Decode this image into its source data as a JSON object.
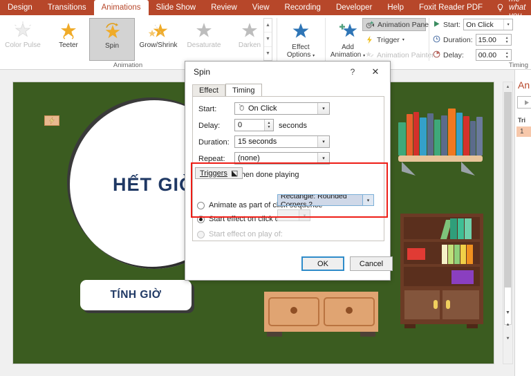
{
  "ribbon": {
    "tabs": [
      {
        "label": "Design",
        "active": false
      },
      {
        "label": "Transitions",
        "active": false
      },
      {
        "label": "Animations",
        "active": true
      },
      {
        "label": "Slide Show",
        "active": false
      },
      {
        "label": "Review",
        "active": false
      },
      {
        "label": "View",
        "active": false
      },
      {
        "label": "Recording",
        "active": false
      },
      {
        "label": "Developer",
        "active": false
      },
      {
        "label": "Help",
        "active": false
      },
      {
        "label": "Foxit Reader PDF",
        "active": false
      }
    ],
    "tellme": "Tell me what you want t",
    "animation_group": {
      "label": "Animation",
      "items": [
        {
          "label": "Color Pulse",
          "state": "disabled"
        },
        {
          "label": "Teeter",
          "state": "normal"
        },
        {
          "label": "Spin",
          "state": "selected"
        },
        {
          "label": "Grow/Shrink",
          "state": "normal"
        },
        {
          "label": "Desaturate",
          "state": "disabled"
        },
        {
          "label": "Darken",
          "state": "disabled"
        }
      ]
    },
    "effect_options": {
      "label_line1": "Effect",
      "label_line2": "Options"
    },
    "advanced_group": {
      "label": "ation",
      "add_animation_line1": "Add",
      "add_animation_line2": "Animation",
      "animation_pane": "Animation Pane",
      "trigger": "Trigger",
      "animation_painter": "Animation Painter"
    },
    "timing_group": {
      "label": "Timing",
      "start_label": "Start:",
      "start_value": "On Click",
      "duration_label": "Duration:",
      "duration_value": "15.00",
      "delay_label": "Delay:",
      "delay_value": "00.00"
    }
  },
  "slide": {
    "circle_text": "HẾT GIỜ",
    "button_text": "TÍNH GIỜ"
  },
  "animation_pane": {
    "title": "An",
    "subtitle": "Tri",
    "item_number": "1"
  },
  "dialog": {
    "title": "Spin",
    "help_glyph": "?",
    "close_glyph": "✕",
    "tabs": [
      {
        "label": "Effect",
        "active": false
      },
      {
        "label": "Timing",
        "active": true
      }
    ],
    "start_label": "Start:",
    "start_value": "On Click",
    "delay_label": "Delay:",
    "delay_value": "0",
    "delay_units": "seconds",
    "duration_label": "Duration:",
    "duration_value": "15 seconds",
    "repeat_label": "Repeat:",
    "repeat_value": "(none)",
    "rewind_label": "Rewind when done playing",
    "triggers_button": "Triggers",
    "triggers_glyph": "⬕",
    "radio_animate": "Animate as part of click sequence",
    "radio_click": "Start effect on click of:",
    "click_target_value": "Rectangle: Rounded Corners 2",
    "radio_play": "Start effect on play of:",
    "ok_label": "OK",
    "cancel_label": "Cancel"
  },
  "colors": {
    "ribbon_red": "#b7472a",
    "slide_green": "#3b5c20",
    "text_navy": "#1f3864",
    "highlight_red": "#ee1c15",
    "selection_blue": "#cfd8e8"
  }
}
